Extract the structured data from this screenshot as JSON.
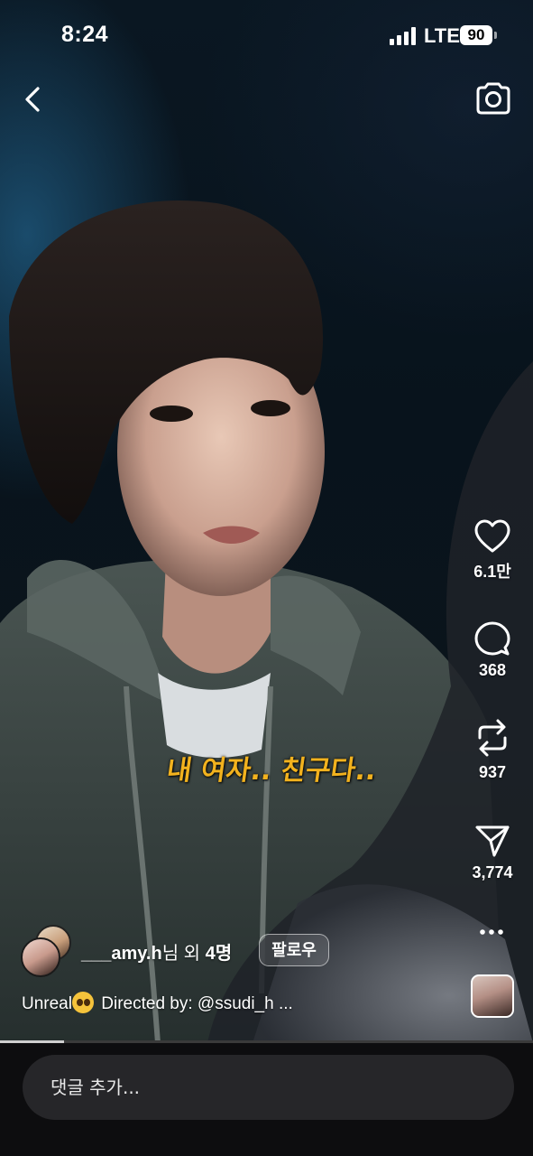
{
  "status_bar": {
    "time": "8:24",
    "network": "LTE",
    "battery": "90"
  },
  "video": {
    "subtitle": "내 여자.. 친구다..",
    "playback_progress": 0.12
  },
  "actions": {
    "like_count": "6.1만",
    "comment_count": "368",
    "repost_count": "937",
    "share_count": "3,774"
  },
  "author": {
    "name": "___amy.h",
    "suffix": "님 외 ",
    "count": "4명",
    "follow_label": "팔로우"
  },
  "caption": {
    "lead": "Unreal",
    "text": " Directed by: @ssudi_h ..."
  },
  "comment": {
    "placeholder": "댓글 추가..."
  },
  "colors": {
    "subtitle": "#f2b21e",
    "background": "#000000",
    "comment_field": "#262629"
  },
  "icons": [
    "back-arrow",
    "camera",
    "heart",
    "speech-bubble",
    "repost-arrows",
    "paper-plane",
    "ellipsis"
  ]
}
